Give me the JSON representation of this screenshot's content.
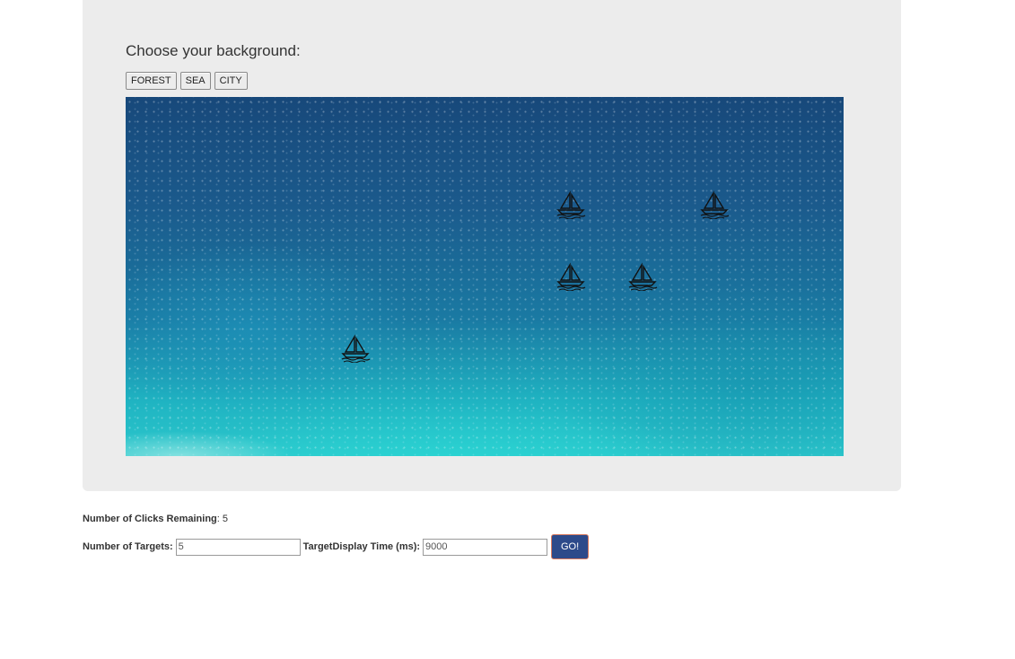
{
  "heading": "Choose your background:",
  "background_buttons": [
    "FOREST",
    "SEA",
    "CITY"
  ],
  "selected_background": "SEA",
  "targets": [
    {
      "name": "sailboat-icon"
    },
    {
      "name": "sailboat-icon"
    },
    {
      "name": "sailboat-icon"
    },
    {
      "name": "sailboat-icon"
    },
    {
      "name": "sailboat-icon"
    }
  ],
  "status": {
    "label": "Number of Clicks Remaining",
    "value": ": 5"
  },
  "controls": {
    "targets_label": "Number of Targets:",
    "targets_value": "5",
    "display_time_label": "TargetDisplay Time (ms):",
    "display_time_value": "9000",
    "go_label": "GO!"
  },
  "colors": {
    "panel_bg": "#ececec",
    "go_button": "#2d4a8a"
  }
}
